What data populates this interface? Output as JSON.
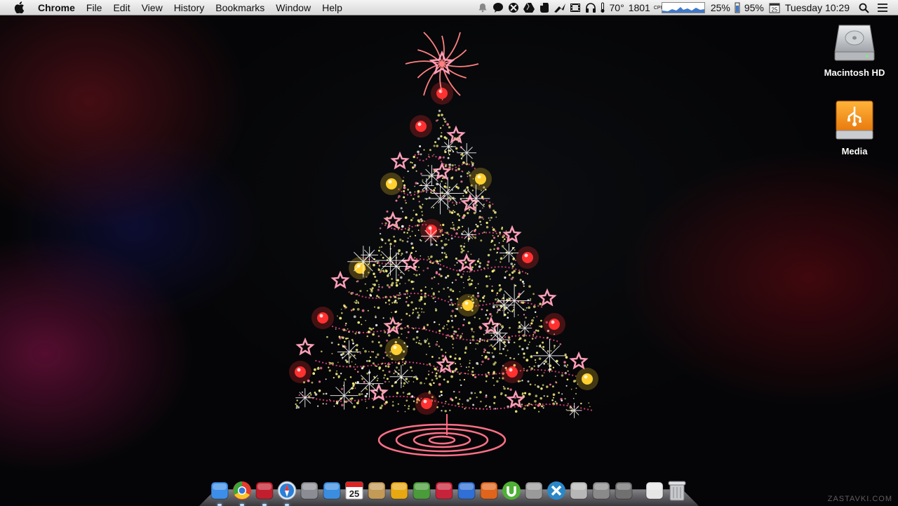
{
  "menubar": {
    "app_name": "Chrome",
    "menus": [
      "File",
      "Edit",
      "View",
      "History",
      "Bookmarks",
      "Window",
      "Help"
    ],
    "status": {
      "temperature": "70°",
      "fan_speed": "1801",
      "cpu_percent": "25%",
      "battery_percent": "95%",
      "calendar_day": "25",
      "clock": "Tuesday 10:29"
    },
    "icons": [
      "notification-bell-icon",
      "chat-bubble-icon",
      "crossed-circle-icon",
      "google-drive-icon",
      "evernote-icon",
      "bird-icon",
      "film-icon",
      "headphones-icon",
      "thermometer-icon",
      "memory-icon",
      "calendar-icon",
      "search-icon",
      "list-icon"
    ]
  },
  "desktop": {
    "icons": [
      {
        "label": "Macintosh HD",
        "icon": "hard-drive-icon"
      },
      {
        "label": "Media",
        "icon": "usb-drive-icon"
      }
    ]
  },
  "wallpaper": {
    "subject": "christmas-tree-icon"
  },
  "dock": {
    "items": [
      {
        "name": "finder-icon",
        "color": "#3c8ee8"
      },
      {
        "name": "chrome-icon",
        "color": "#e33b2e"
      },
      {
        "name": "photo-booth-icon",
        "color": "#c21f2e"
      },
      {
        "name": "safari-icon",
        "color": "#2a7fd6"
      },
      {
        "name": "rocket-icon",
        "color": "#8c8c95"
      },
      {
        "name": "itunes-icon",
        "color": "#3b8de0"
      },
      {
        "name": "calendar-icon",
        "color": "#ffffff",
        "text": "25"
      },
      {
        "name": "contacts-icon",
        "color": "#c49a57"
      },
      {
        "name": "wunderlist-icon",
        "color": "#e8a812"
      },
      {
        "name": "evernote-icon",
        "color": "#4a9b3a"
      },
      {
        "name": "sparrow-icon",
        "color": "#c7233a"
      },
      {
        "name": "google-icon",
        "color": "#2f6fd6"
      },
      {
        "name": "activity-monitor-icon",
        "color": "#e0641b"
      },
      {
        "name": "utorrent-icon",
        "color": "#4fb036"
      },
      {
        "name": "calculator-icon",
        "color": "#9a9a9a"
      },
      {
        "name": "x-app-icon",
        "color": "#2a88c8"
      },
      {
        "name": "preview-icon",
        "color": "#b7b7b7"
      },
      {
        "name": "automator-icon",
        "color": "#8a8a8a"
      },
      {
        "name": "system-preferences-icon",
        "color": "#707070"
      },
      {
        "name": "downloads-stack-icon",
        "color": "#e6e6e6"
      },
      {
        "name": "trash-icon",
        "color": "#b9b9b9"
      }
    ]
  },
  "watermark": "ZASTAVKI.COM"
}
